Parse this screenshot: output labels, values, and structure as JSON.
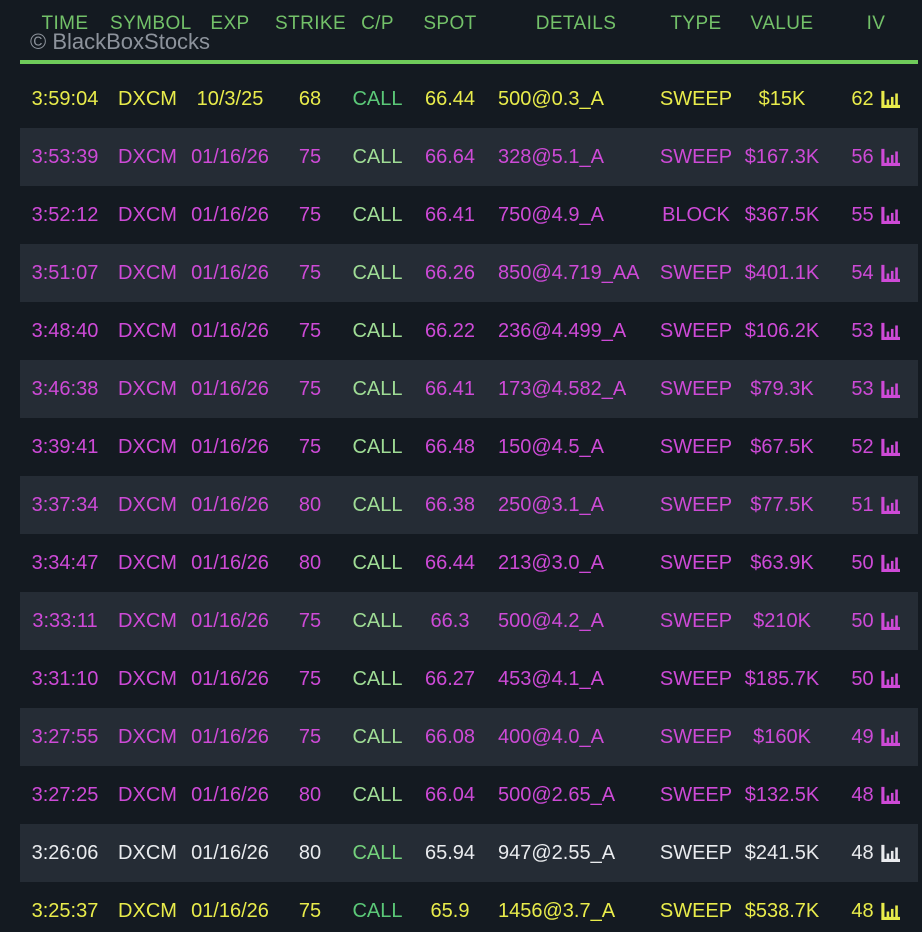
{
  "header": {
    "columns": [
      "TIME",
      "SYMBOL",
      "EXP",
      "STRIKE",
      "C/P",
      "SPOT",
      "DETAILS",
      "TYPE",
      "VALUE",
      "IV"
    ],
    "watermark": "© BlackBoxStocks"
  },
  "colors": {
    "background": "#141a21",
    "stripe": "#252c35",
    "header_green": "#73c169",
    "line_green": "#6fcb5a",
    "watermark_gray": "#8d939c",
    "row_variants": {
      "yellow": "#e9ec4b",
      "magenta": "#ce4ad7",
      "white": "#e9ebee"
    },
    "call_variants": {
      "yellow": "#5bc878",
      "magenta": "#9fdc95",
      "white": "#74d17c"
    }
  },
  "icons": {
    "iv_icon": "bar-chart-icon"
  },
  "rows": [
    {
      "time": "3:59:04",
      "symbol": "DXCM",
      "exp": "10/3/25",
      "strike": "68",
      "cp": "CALL",
      "spot": "66.44",
      "details": "500@0.3_A",
      "type": "SWEEP",
      "value": "$15K",
      "iv": "62",
      "variant": "yellow"
    },
    {
      "time": "3:53:39",
      "symbol": "DXCM",
      "exp": "01/16/26",
      "strike": "75",
      "cp": "CALL",
      "spot": "66.64",
      "details": "328@5.1_A",
      "type": "SWEEP",
      "value": "$167.3K",
      "iv": "56",
      "variant": "magenta"
    },
    {
      "time": "3:52:12",
      "symbol": "DXCM",
      "exp": "01/16/26",
      "strike": "75",
      "cp": "CALL",
      "spot": "66.41",
      "details": "750@4.9_A",
      "type": "BLOCK",
      "value": "$367.5K",
      "iv": "55",
      "variant": "magenta"
    },
    {
      "time": "3:51:07",
      "symbol": "DXCM",
      "exp": "01/16/26",
      "strike": "75",
      "cp": "CALL",
      "spot": "66.26",
      "details": "850@4.719_AA",
      "type": "SWEEP",
      "value": "$401.1K",
      "iv": "54",
      "variant": "magenta"
    },
    {
      "time": "3:48:40",
      "symbol": "DXCM",
      "exp": "01/16/26",
      "strike": "75",
      "cp": "CALL",
      "spot": "66.22",
      "details": "236@4.499_A",
      "type": "SWEEP",
      "value": "$106.2K",
      "iv": "53",
      "variant": "magenta"
    },
    {
      "time": "3:46:38",
      "symbol": "DXCM",
      "exp": "01/16/26",
      "strike": "75",
      "cp": "CALL",
      "spot": "66.41",
      "details": "173@4.582_A",
      "type": "SWEEP",
      "value": "$79.3K",
      "iv": "53",
      "variant": "magenta"
    },
    {
      "time": "3:39:41",
      "symbol": "DXCM",
      "exp": "01/16/26",
      "strike": "75",
      "cp": "CALL",
      "spot": "66.48",
      "details": "150@4.5_A",
      "type": "SWEEP",
      "value": "$67.5K",
      "iv": "52",
      "variant": "magenta"
    },
    {
      "time": "3:37:34",
      "symbol": "DXCM",
      "exp": "01/16/26",
      "strike": "80",
      "cp": "CALL",
      "spot": "66.38",
      "details": "250@3.1_A",
      "type": "SWEEP",
      "value": "$77.5K",
      "iv": "51",
      "variant": "magenta"
    },
    {
      "time": "3:34:47",
      "symbol": "DXCM",
      "exp": "01/16/26",
      "strike": "80",
      "cp": "CALL",
      "spot": "66.44",
      "details": "213@3.0_A",
      "type": "SWEEP",
      "value": "$63.9K",
      "iv": "50",
      "variant": "magenta"
    },
    {
      "time": "3:33:11",
      "symbol": "DXCM",
      "exp": "01/16/26",
      "strike": "75",
      "cp": "CALL",
      "spot": "66.3",
      "details": "500@4.2_A",
      "type": "SWEEP",
      "value": "$210K",
      "iv": "50",
      "variant": "magenta"
    },
    {
      "time": "3:31:10",
      "symbol": "DXCM",
      "exp": "01/16/26",
      "strike": "75",
      "cp": "CALL",
      "spot": "66.27",
      "details": "453@4.1_A",
      "type": "SWEEP",
      "value": "$185.7K",
      "iv": "50",
      "variant": "magenta"
    },
    {
      "time": "3:27:55",
      "symbol": "DXCM",
      "exp": "01/16/26",
      "strike": "75",
      "cp": "CALL",
      "spot": "66.08",
      "details": "400@4.0_A",
      "type": "SWEEP",
      "value": "$160K",
      "iv": "49",
      "variant": "magenta"
    },
    {
      "time": "3:27:25",
      "symbol": "DXCM",
      "exp": "01/16/26",
      "strike": "80",
      "cp": "CALL",
      "spot": "66.04",
      "details": "500@2.65_A",
      "type": "SWEEP",
      "value": "$132.5K",
      "iv": "48",
      "variant": "magenta"
    },
    {
      "time": "3:26:06",
      "symbol": "DXCM",
      "exp": "01/16/26",
      "strike": "80",
      "cp": "CALL",
      "spot": "65.94",
      "details": "947@2.55_A",
      "type": "SWEEP",
      "value": "$241.5K",
      "iv": "48",
      "variant": "white"
    },
    {
      "time": "3:25:37",
      "symbol": "DXCM",
      "exp": "01/16/26",
      "strike": "75",
      "cp": "CALL",
      "spot": "65.9",
      "details": "1456@3.7_A",
      "type": "SWEEP",
      "value": "$538.7K",
      "iv": "48",
      "variant": "yellow"
    }
  ]
}
